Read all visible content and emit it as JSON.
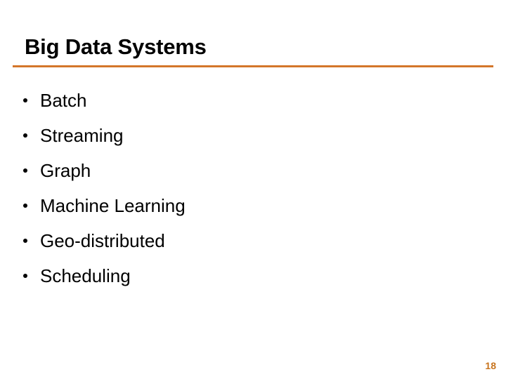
{
  "slide": {
    "title": "Big Data Systems",
    "page_number": "18",
    "accent_color": "#d4762a",
    "page_number_color": "#c8741e",
    "text_color": "#000000",
    "background_color": "#ffffff",
    "bullets": [
      {
        "label": "Batch"
      },
      {
        "label": "Streaming"
      },
      {
        "label": "Graph"
      },
      {
        "label": "Machine Learning"
      },
      {
        "label": "Geo-distributed"
      },
      {
        "label": "Scheduling"
      }
    ]
  }
}
